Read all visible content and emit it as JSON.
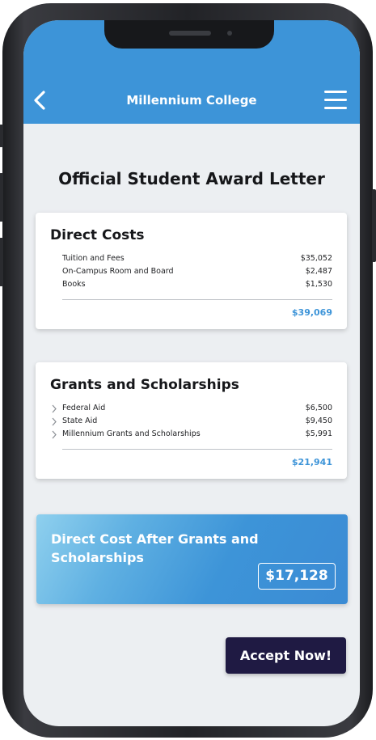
{
  "header": {
    "title": "Millennium College",
    "back_icon": "chevron-left-icon",
    "menu_icon": "hamburger-menu-icon",
    "color": "#3d94d8"
  },
  "page": {
    "title": "Official Student Award Letter"
  },
  "direct_costs": {
    "title": "Direct Costs",
    "items": [
      {
        "label": "Tuition and Fees",
        "amount": "$35,052"
      },
      {
        "label": "On-Campus Room and Board",
        "amount": "$2,487"
      },
      {
        "label": "Books",
        "amount": "$1,530"
      }
    ],
    "total": "$39,069"
  },
  "grants": {
    "title": "Grants and Scholarships",
    "items": [
      {
        "label": "Federal Aid",
        "amount": "$6,500"
      },
      {
        "label": "State Aid",
        "amount": "$9,450"
      },
      {
        "label": "Millennium Grants and Scholarships",
        "amount": "$5,991"
      }
    ],
    "total": "$21,941"
  },
  "net_cost": {
    "title": "Direct Cost After Grants and Scholarships",
    "amount": "$17,128"
  },
  "actions": {
    "accept_label": "Accept Now!",
    "accept_color": "#1f1a43"
  }
}
